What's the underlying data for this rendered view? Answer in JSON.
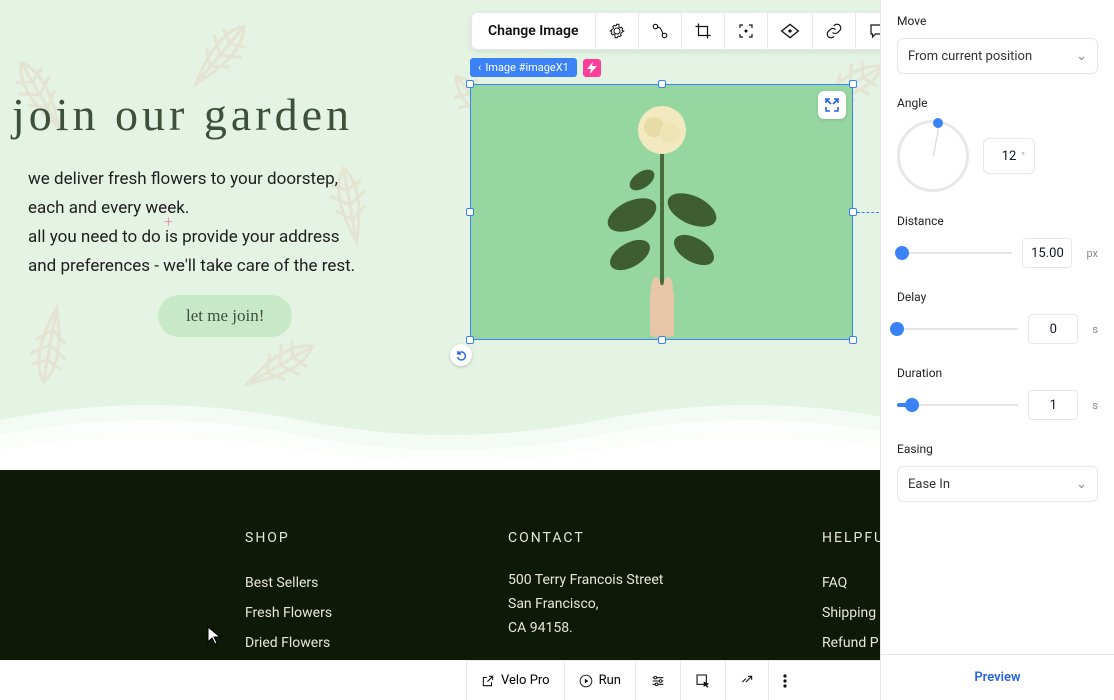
{
  "hero": {
    "headline": "join our garden",
    "line1": "we deliver fresh flowers to your doorstep,",
    "line2": "each and every week.",
    "line3": "all you need to do is provide your address",
    "line4": "and preferences - we'll take care of the rest.",
    "cta": "let me join!"
  },
  "selection": {
    "label": "Image #imageX1"
  },
  "toolbar": {
    "change_image": "Change Image"
  },
  "footer": {
    "shop": {
      "title": "SHOP",
      "items": [
        "Best Sellers",
        "Fresh Flowers",
        "Dried Flowers"
      ]
    },
    "contact": {
      "title": "CONTACT",
      "lines": [
        "500 Terry Francois Street",
        "San Francisco,",
        "CA 94158."
      ]
    },
    "links": {
      "title": "HELPFU",
      "items": [
        "FAQ",
        "Shipping",
        "Refund P"
      ]
    }
  },
  "panel": {
    "move": {
      "label": "Move",
      "value": "From current position"
    },
    "angle": {
      "label": "Angle",
      "value": "12",
      "unit": "°"
    },
    "distance": {
      "label": "Distance",
      "value": "15.00",
      "unit": "px",
      "pct": 4
    },
    "delay": {
      "label": "Delay",
      "value": "0",
      "unit": "s",
      "pct": 0
    },
    "duration": {
      "label": "Duration",
      "value": "1",
      "unit": "s",
      "pct": 12
    },
    "easing": {
      "label": "Easing",
      "value": "Ease In"
    },
    "preview": "Preview"
  },
  "devbar": {
    "velo": "Velo Pro",
    "run": "Run"
  }
}
